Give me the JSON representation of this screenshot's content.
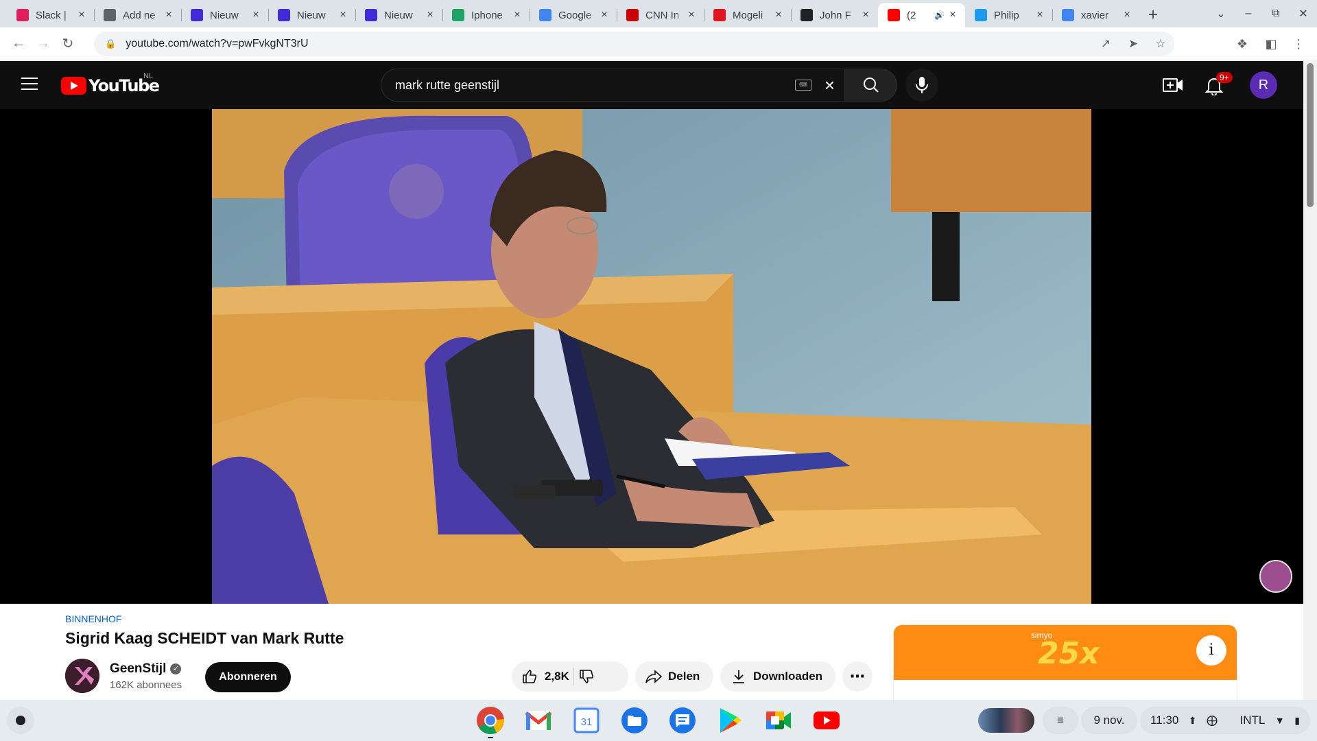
{
  "browser": {
    "tabs": [
      {
        "title": "Slack | ",
        "favicon": "slack-icon",
        "color": "#e01e5a"
      },
      {
        "title": "Add ne",
        "favicon": "globe-icon",
        "color": "#5f6368"
      },
      {
        "title": "Nieuw",
        "favicon": "n-icon",
        "color": "#3f2bd8"
      },
      {
        "title": "Nieuw",
        "favicon": "n-icon",
        "color": "#3f2bd8"
      },
      {
        "title": "Nieuw",
        "favicon": "n-icon",
        "color": "#3f2bd8"
      },
      {
        "title": "Iphone",
        "favicon": "spreadsheet-icon",
        "color": "#1fa463"
      },
      {
        "title": "Google",
        "favicon": "docs-icon",
        "color": "#4285f4"
      },
      {
        "title": "CNN In",
        "favicon": "cnn-icon",
        "color": "#cc0000"
      },
      {
        "title": "Mogeli",
        "favicon": "opera-icon",
        "color": "#e0151f"
      },
      {
        "title": "John F",
        "favicon": "text-cursor-icon",
        "color": "#202124"
      },
      {
        "title": "(2",
        "favicon": "youtube-icon",
        "color": "#ff0000",
        "active": true
      },
      {
        "title": "Philip",
        "favicon": "twitter-icon",
        "color": "#1d9bf0"
      },
      {
        "title": "xavier",
        "favicon": "google-icon",
        "color": "#4285f4"
      }
    ],
    "url": "youtube.com/watch?v=pwFvkgNT3rU"
  },
  "youtube": {
    "logo_text": "YouTube",
    "region": "NL",
    "search_query": "mark rutte geenstijl",
    "notification_badge": "9+",
    "avatar_letter": "R"
  },
  "video": {
    "hashtag": "BINNENHOF",
    "title": "Sigrid Kaag SCHEIDT van Mark Rutte",
    "channel": "GeenStijl",
    "subscribers": "162K abonnees",
    "subscribe_label": "Abonneren",
    "likes": "2,8K",
    "share_label": "Delen",
    "download_label": "Downloaden"
  },
  "ad": {
    "brand": "simyo",
    "headline": "25x"
  },
  "shelf": {
    "apps": [
      "chrome-icon",
      "gmail-icon",
      "calendar-icon",
      "files-icon",
      "messages-icon",
      "play-store-icon",
      "meet-icon",
      "youtube-icon"
    ],
    "calendar_day": "31",
    "date": "9 nov.",
    "time": "11:30",
    "keyboard": "INTL"
  }
}
